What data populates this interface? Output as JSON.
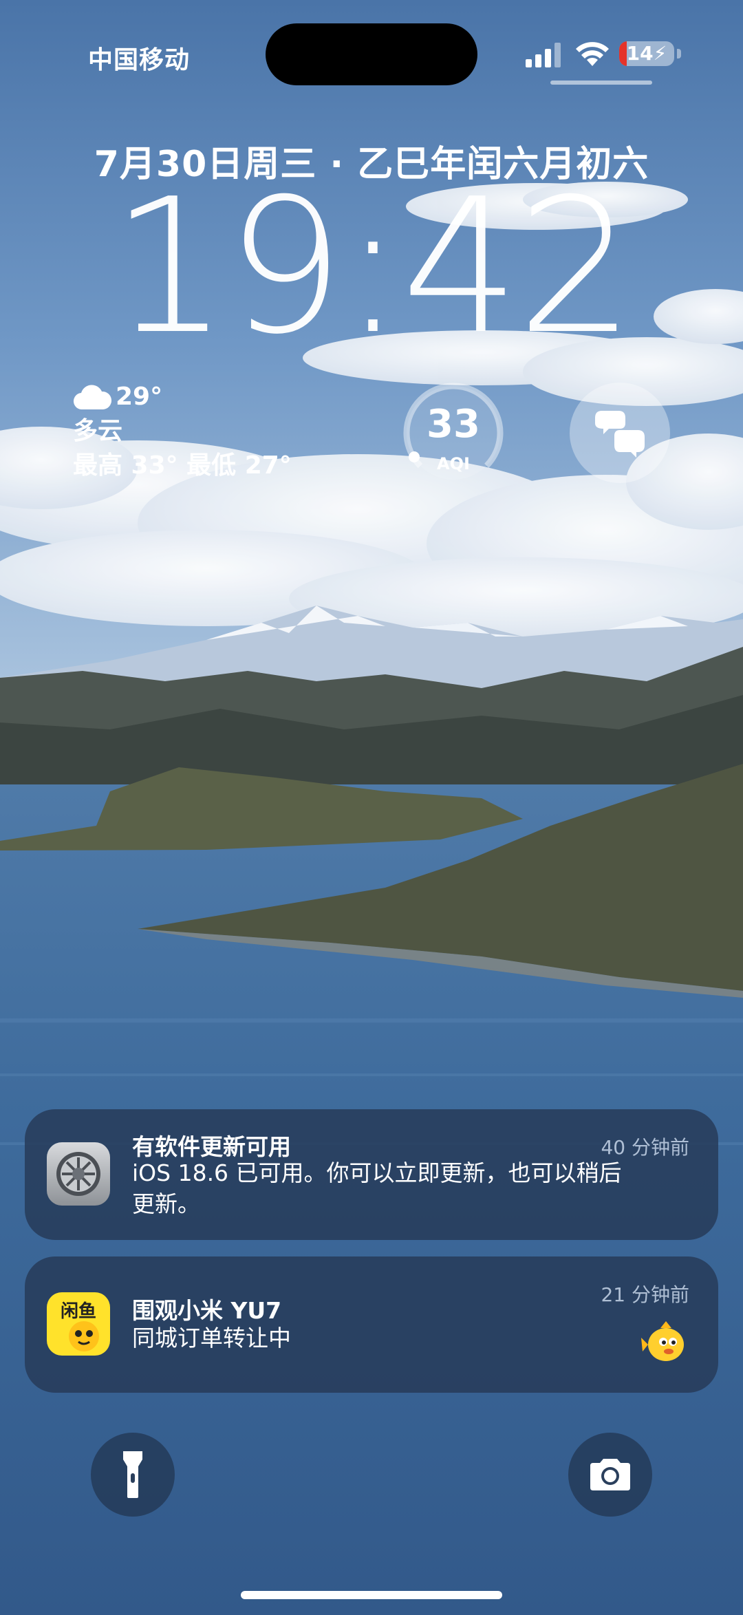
{
  "status_bar": {
    "carrier": "中国移动",
    "battery_level": "14",
    "battery_fraction": 0.14,
    "battery_color": "#e5332a",
    "icons": [
      "signal-icon",
      "wifi-icon",
      "battery-charging-icon"
    ]
  },
  "lock": {
    "date": "7月30日周三 · 乙巳年闰六月初六",
    "time": "19:42"
  },
  "widgets": {
    "weather": {
      "icon": "cloud-icon",
      "temperature": "29°",
      "condition": "多云",
      "range": "最高 33° 最低 27°"
    },
    "aqi": {
      "value": "33",
      "label": "AQI",
      "level_fraction": 0.1
    },
    "shortcut": {
      "icon": "focus-shortcut-icon"
    }
  },
  "notifications": [
    {
      "app_icon": "settings-gear-icon",
      "title": "有软件更新可用",
      "body": "iOS 18.6 已可用。你可以立即更新，也可以稍后更新。",
      "time": "40 分钟前"
    },
    {
      "app_icon": "xianyu-app-icon",
      "app_icon_text": "闲鱼",
      "title": "围观小米 YU7",
      "body": "同城订单转让中",
      "time": "21 分钟前",
      "thumbnail": "fish-mascot-icon"
    }
  ],
  "controls": {
    "left": "flashlight-icon",
    "right": "camera-icon"
  }
}
